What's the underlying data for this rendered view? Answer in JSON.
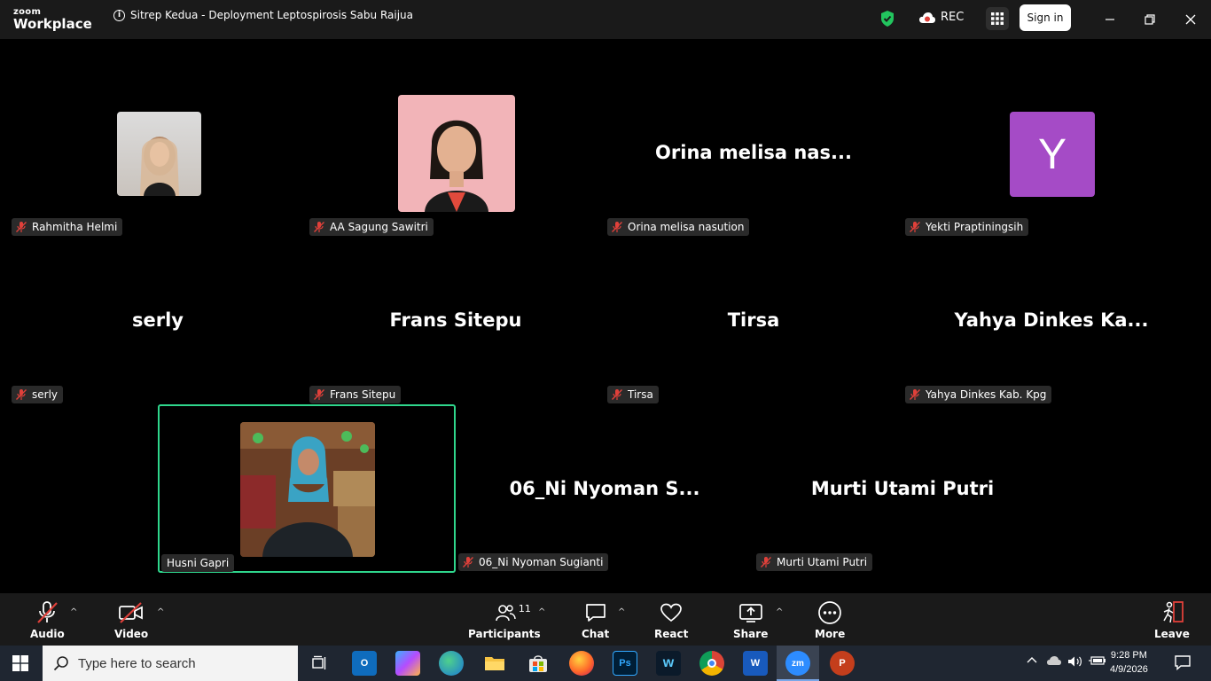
{
  "app": {
    "logo_top": "zoom",
    "logo_bottom": "Workplace",
    "meeting_title": "Sitrep Kedua - Deployment Leptospirosis Sabu Raijua",
    "rec_label": "REC",
    "signin_label": "Sign in"
  },
  "tiles": [
    {
      "id": "rahmitha",
      "name": "Rahmitha Helmi",
      "muted": true,
      "display": "photo"
    },
    {
      "id": "sagung",
      "name": "AA Sagung Sawitri",
      "muted": true,
      "display": "photo"
    },
    {
      "id": "orina",
      "name": "Orina melisa nasution",
      "big_label": "Orina  melisa  nas...",
      "muted": true,
      "display": "text"
    },
    {
      "id": "yekti",
      "name": "Yekti Praptiningsih",
      "avatar_letter": "Y",
      "muted": true,
      "display": "letter"
    },
    {
      "id": "serly",
      "name": "serly",
      "big_label": "serly",
      "muted": true,
      "display": "text"
    },
    {
      "id": "frans",
      "name": "Frans Sitepu",
      "big_label": "Frans  Sitepu",
      "muted": true,
      "display": "text"
    },
    {
      "id": "tirsa",
      "name": "Tirsa",
      "big_label": "Tirsa",
      "muted": true,
      "display": "text"
    },
    {
      "id": "yahya",
      "name": "Yahya Dinkes Kab. Kpg",
      "big_label": "Yahya  Dinkes  Ka...",
      "muted": true,
      "display": "text"
    },
    {
      "id": "husni",
      "name": "Husni Gapri",
      "muted": false,
      "active_speaker": true,
      "display": "photo"
    },
    {
      "id": "nyoman",
      "name": "06_Ni Nyoman Sugianti",
      "big_label": "06_Ni  Nyoman  S...",
      "muted": true,
      "display": "text"
    },
    {
      "id": "murti",
      "name": "Murti Utami Putri",
      "big_label": "Murti  Utami  Putri",
      "muted": true,
      "display": "text"
    }
  ],
  "toolbar": {
    "audio": "Audio",
    "video": "Video",
    "participants": "Participants",
    "participants_count": "11",
    "chat": "Chat",
    "react": "React",
    "share": "Share",
    "more": "More",
    "leave": "Leave"
  },
  "taskbar": {
    "search_placeholder": "Type here to search",
    "time": "9:28 PM",
    "date": "4/9/2026",
    "apps": [
      "task-view",
      "outlook",
      "copilot",
      "edge",
      "file-explorer",
      "microsoft-store",
      "firefox",
      "photoshop",
      "webex",
      "chrome",
      "word",
      "zoom",
      "powerpoint"
    ]
  },
  "colors": {
    "active_speaker_border": "#2fd68c",
    "muted_icon": "#e0403a",
    "avatar_purple": "#a54bc6",
    "titlebar_bg": "#1a1a1a"
  }
}
